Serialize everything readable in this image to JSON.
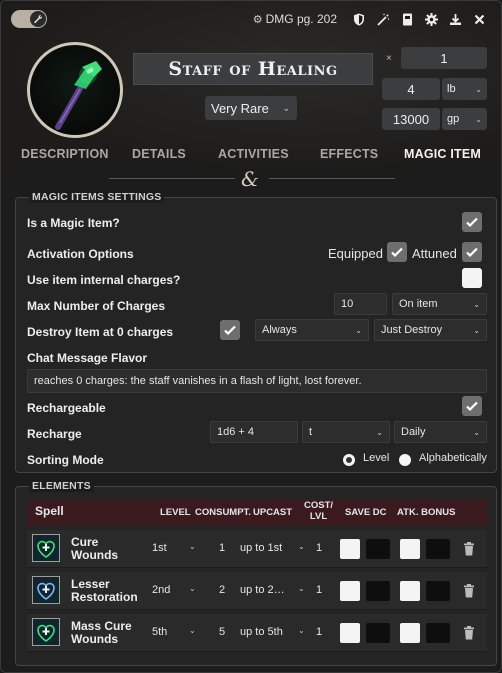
{
  "header": {
    "source_label": "DMG pg. 202",
    "item_name": "Staff of Healing",
    "rarity": "Very Rare",
    "quantity_prefix": "×",
    "quantity": "1",
    "weight": "4",
    "weight_unit": "lb",
    "price": "13000",
    "price_unit": "gp"
  },
  "tabs": [
    {
      "label": "DESCRIPTION"
    },
    {
      "label": "DETAILS"
    },
    {
      "label": "ACTIVITIES"
    },
    {
      "label": "EFFECTS"
    },
    {
      "label": "MAGIC ITEM",
      "active": true
    }
  ],
  "settings": {
    "legend": "MAGIC ITEMS SETTINGS",
    "is_magic_label": "Is a Magic Item?",
    "is_magic": true,
    "activation_label": "Activation Options",
    "equipped_label": "Equipped",
    "equipped": true,
    "attuned_label": "Attuned",
    "attuned": true,
    "internal_charges_label": "Use item internal charges?",
    "internal_charges": false,
    "max_charges_label": "Max Number of Charges",
    "max_charges": "10",
    "max_charges_mode": "On item",
    "destroy_label": "Destroy Item at 0 charges",
    "destroy": true,
    "destroy_when": "Always",
    "destroy_mode": "Just Destroy",
    "chat_flavor_label": "Chat Message Flavor",
    "chat_flavor": "reaches 0 charges: the staff vanishes in a flash of light, lost forever.",
    "rechargeable_label": "Rechargeable",
    "rechargeable": true,
    "recharge_label": "Recharge",
    "recharge_formula": "1d6 + 4",
    "recharge_type": "t",
    "recharge_time": "Daily",
    "sorting_label": "Sorting Mode",
    "sort_level_label": "Level",
    "sort_alpha_label": "Alphabetically",
    "sort_selected": "Level"
  },
  "elements": {
    "legend": "ELEMENTS",
    "columns": {
      "spell": "Spell",
      "level": "LEVEL",
      "consumpt": "CONSUMPT.",
      "upcast": "UPCAST",
      "cost_a": "COST/",
      "cost_b": "LVL",
      "save_dc": "SAVE DC",
      "atk_bonus": "ATK. BONUS"
    },
    "spells": [
      {
        "name_a": "Cure",
        "name_b": "Wounds",
        "level": "1st",
        "consumption": "1",
        "upcast": "up to 1st",
        "cost": "1",
        "icon": "heart-plus-icon"
      },
      {
        "name_a": "Lesser",
        "name_b": "Restoration",
        "level": "2nd",
        "consumption": "2",
        "upcast": "up to 2…",
        "cost": "1",
        "icon": "heart-plus-icon"
      },
      {
        "name_a": "Mass Cure",
        "name_b": "Wounds",
        "level": "5th",
        "consumption": "5",
        "upcast": "up to 5th",
        "cost": "1",
        "icon": "heart-plus-icon"
      }
    ]
  },
  "colors": {
    "accent_header": "#3a1a1e",
    "spell_icon_green": "#3fe07a"
  }
}
